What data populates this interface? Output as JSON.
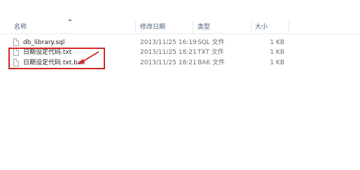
{
  "columns": {
    "name": "名称",
    "date": "修改日期",
    "type": "类型",
    "size": "大小"
  },
  "files": [
    {
      "name": "db_library.sql",
      "date": "2013/11/25 16:19",
      "type": "SQL 文件",
      "size": "1 KB"
    },
    {
      "name": "日期设定代码.txt",
      "date": "2013/11/25 18:21",
      "type": "TXT 文件",
      "size": "1 KB"
    },
    {
      "name": "日期设定代码.txt.bak",
      "date": "2013/11/25 18:21",
      "type": "BAK 文件",
      "size": "1 KB"
    }
  ],
  "colors": {
    "annotation": "#d32727",
    "header_text": "#4c607a"
  },
  "icons": {
    "file": "document-icon",
    "sort": "sort-ascending-icon"
  }
}
